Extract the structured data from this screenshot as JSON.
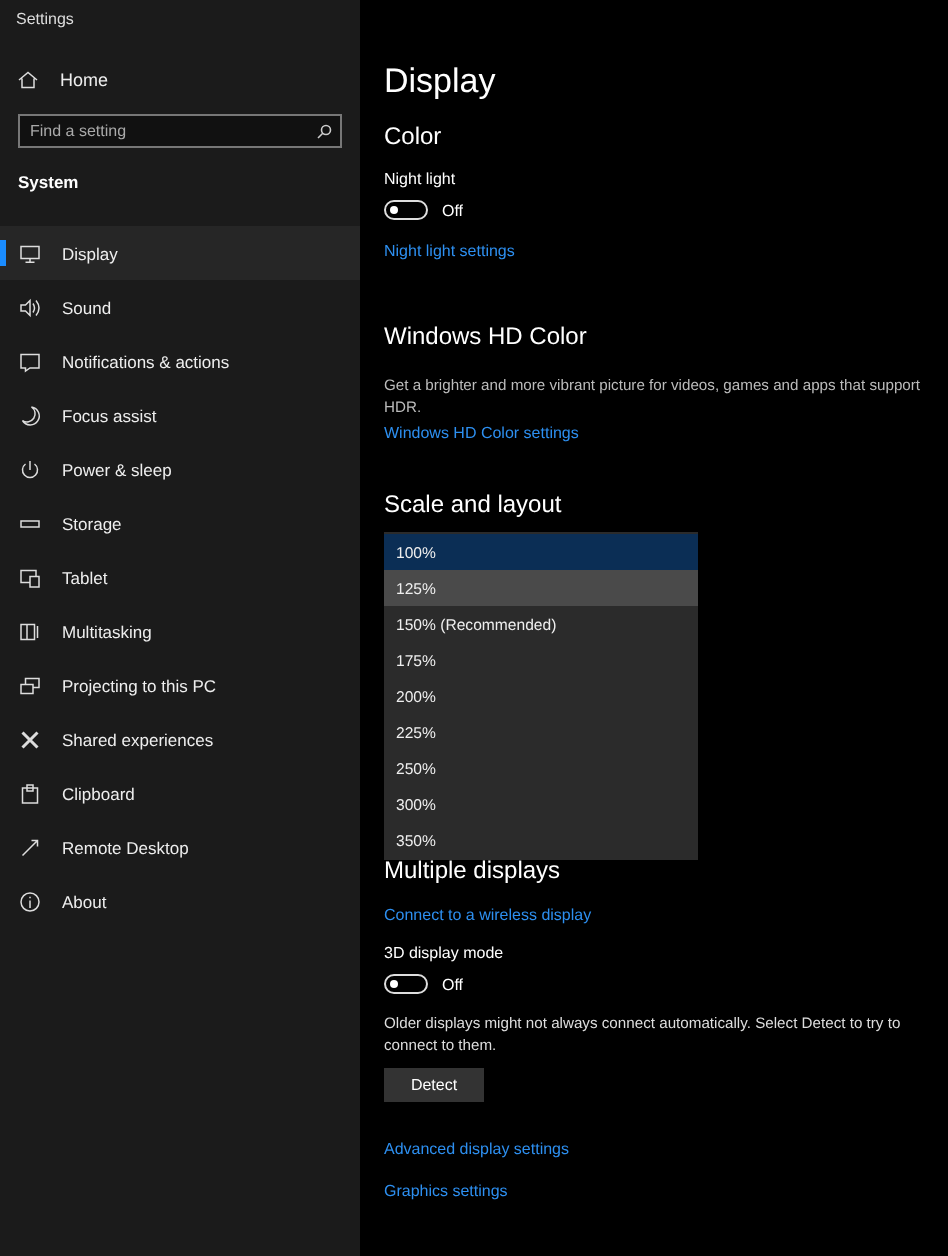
{
  "window": {
    "title": "Settings"
  },
  "sidebar": {
    "home": "Home",
    "search": {
      "placeholder": "Find a setting"
    },
    "section": "System",
    "items": [
      {
        "label": "Display",
        "selected": true
      },
      {
        "label": "Sound",
        "selected": false
      },
      {
        "label": "Notifications & actions",
        "selected": false
      },
      {
        "label": "Focus assist",
        "selected": false
      },
      {
        "label": "Power & sleep",
        "selected": false
      },
      {
        "label": "Storage",
        "selected": false
      },
      {
        "label": "Tablet",
        "selected": false
      },
      {
        "label": "Multitasking",
        "selected": false
      },
      {
        "label": "Projecting to this PC",
        "selected": false
      },
      {
        "label": "Shared experiences",
        "selected": false
      },
      {
        "label": "Clipboard",
        "selected": false
      },
      {
        "label": "Remote Desktop",
        "selected": false
      },
      {
        "label": "About",
        "selected": false
      }
    ]
  },
  "page": {
    "title": "Display",
    "color": {
      "heading": "Color",
      "night_light": {
        "label": "Night light",
        "on": false,
        "state": "Off"
      },
      "link": "Night light settings"
    },
    "hd_color": {
      "heading": "Windows HD Color",
      "description": "Get a brighter and more vibrant picture for videos, games and apps that support HDR.",
      "link": "Windows HD Color settings"
    },
    "scale": {
      "heading": "Scale and layout",
      "dropdown": [
        {
          "label": "100%",
          "selected": true,
          "hovered": false
        },
        {
          "label": "125%",
          "selected": false,
          "hovered": true
        },
        {
          "label": "150% (Recommended)",
          "selected": false,
          "hovered": false
        },
        {
          "label": "175%",
          "selected": false,
          "hovered": false
        },
        {
          "label": "200%",
          "selected": false,
          "hovered": false
        },
        {
          "label": "225%",
          "selected": false,
          "hovered": false
        },
        {
          "label": "250%",
          "selected": false,
          "hovered": false
        },
        {
          "label": "300%",
          "selected": false,
          "hovered": false
        },
        {
          "label": "350%",
          "selected": false,
          "hovered": false
        }
      ]
    },
    "multiple": {
      "heading": "Multiple displays",
      "link": "Connect to a wireless display",
      "mode3d": {
        "label": "3D display mode",
        "on": false,
        "state": "Off"
      },
      "description": "Older displays might not always connect automatically. Select Detect to try to connect to them.",
      "button": "Detect"
    },
    "links": [
      "Advanced display settings",
      "Graphics settings"
    ]
  }
}
